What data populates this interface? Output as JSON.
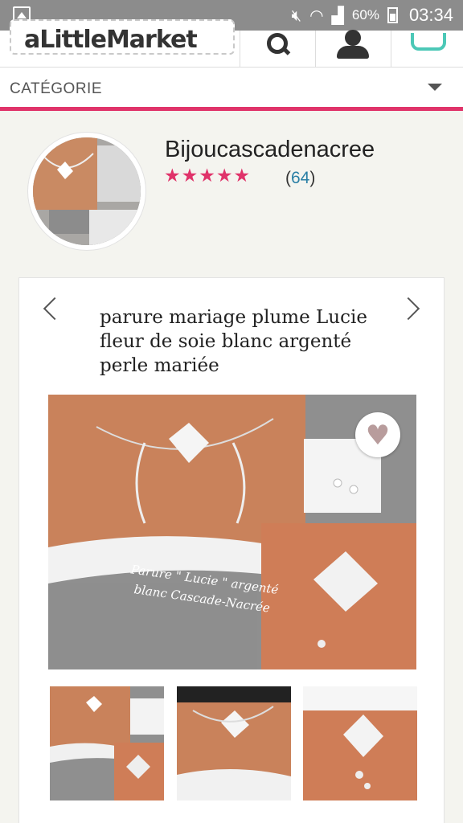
{
  "status_bar": {
    "battery": "60%",
    "time": "03:34"
  },
  "header": {
    "logo_text": "aLittleMarket",
    "search_icon": "search-icon",
    "account_icon": "user-icon",
    "cart_icon": "basket-icon"
  },
  "category": {
    "label": "CATÉGORIE"
  },
  "shop": {
    "name": "Bijoucascadenacree",
    "stars": "★★★★★",
    "rating_open": "(",
    "rating_count": "64",
    "rating_close": ")",
    "rating_value": 5,
    "accent": "#e0336a"
  },
  "product": {
    "title": "parure mariage plume Lucie fleur de soie blanc argenté perle mariée",
    "image_caption": "Parure \" Lucie \" argenté blanc Cascade-Nacrée",
    "favorite_icon": "heart-icon"
  }
}
